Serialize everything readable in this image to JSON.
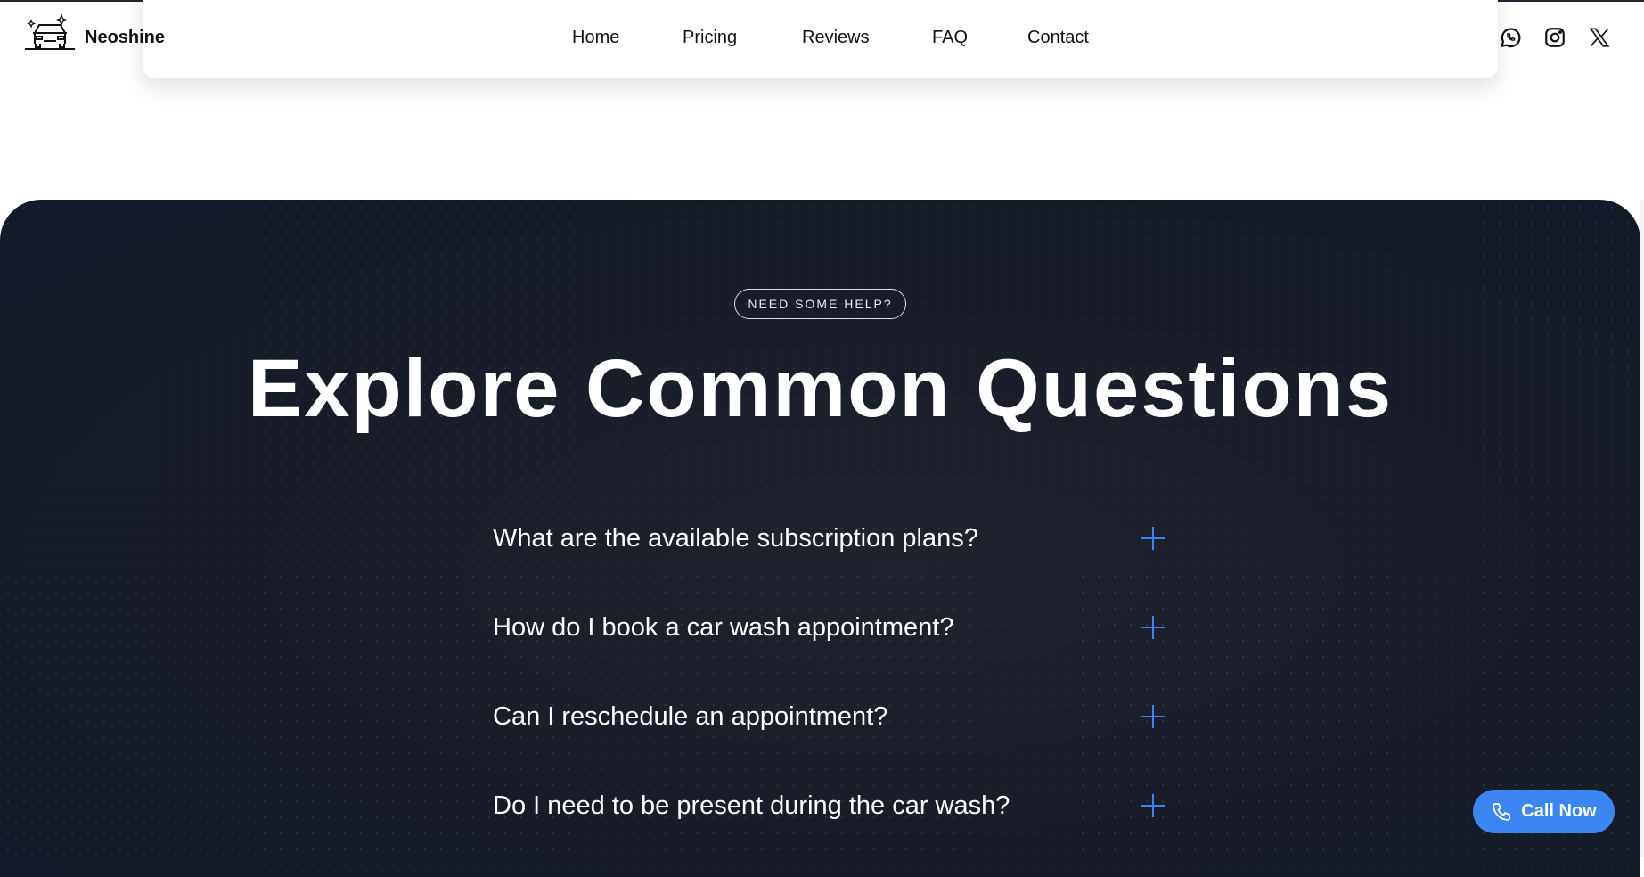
{
  "header": {
    "brand": "Neoshine",
    "nav": [
      "Home",
      "Pricing",
      "Reviews",
      "FAQ",
      "Contact"
    ],
    "social": [
      "whatsapp-icon",
      "instagram-icon",
      "x-icon"
    ]
  },
  "faq": {
    "badge": "NEED SOME HELP?",
    "title": "Explore Common Questions",
    "items": [
      {
        "question": "What are the available subscription plans?"
      },
      {
        "question": "How do I book a car wash appointment?"
      },
      {
        "question": "Can I reschedule an appointment?"
      },
      {
        "question": "Do I need to be present during the car wash?"
      }
    ]
  },
  "cta": {
    "label": "Call Now",
    "color": "#3b86f2"
  },
  "colors": {
    "accent": "#3b82f6",
    "section_bg": "#171c28"
  }
}
